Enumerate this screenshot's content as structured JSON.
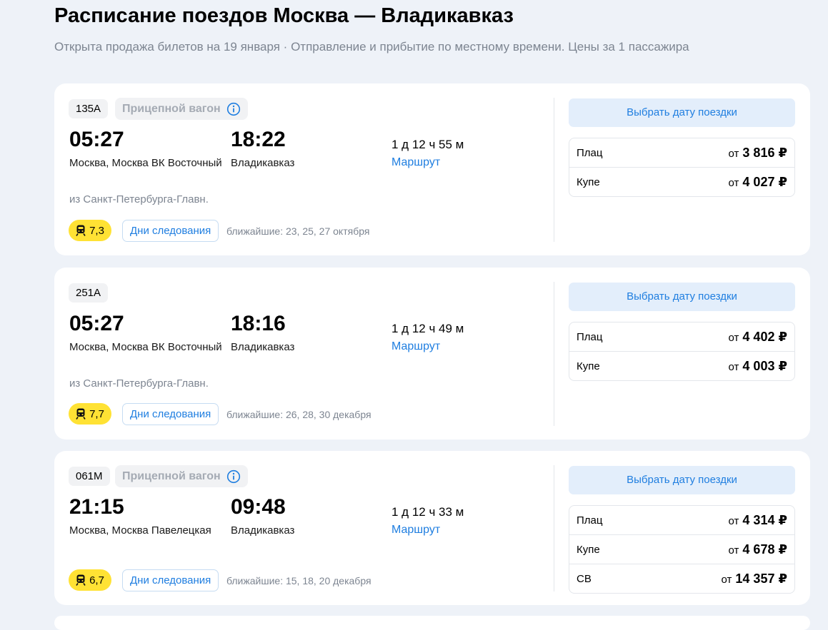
{
  "page": {
    "title": "Расписание поездов Москва — Владикавказ",
    "subtitle": "Открыта продажа билетов на 19 января · Отправление и прибытие по местному времени. Цены за 1 пассажира"
  },
  "colors": {
    "accent": "#1f7ee0",
    "rating_bg": "#ffe234",
    "page_bg": "#eef2f8"
  },
  "trains": [
    {
      "number": "135А",
      "wagon_badge": "Прицепной вагон",
      "departure_time": "05:27",
      "departure_station": "Москва, Москва ВК Восточный",
      "origin": "из Санкт-Петербурга-Главн.",
      "arrival_time": "18:22",
      "arrival_station": "Владикавказ",
      "duration": "1 д 12 ч 55 м",
      "route_label": "Маршрут",
      "rating": "7,3",
      "days_label": "Дни следования",
      "nearest": "ближайшие: 23, 25, 27 октября",
      "choose_label": "Выбрать дату поездки",
      "prices": [
        {
          "class": "Плац",
          "from": "от",
          "amount": "3 816 ₽"
        },
        {
          "class": "Купе",
          "from": "от",
          "amount": "4 027 ₽"
        }
      ]
    },
    {
      "number": "251А",
      "departure_time": "05:27",
      "departure_station": "Москва, Москва ВК Восточный",
      "origin": "из Санкт-Петербурга-Главн.",
      "arrival_time": "18:16",
      "arrival_station": "Владикавказ",
      "duration": "1 д 12 ч 49 м",
      "route_label": "Маршрут",
      "rating": "7,7",
      "days_label": "Дни следования",
      "nearest": "ближайшие: 26, 28, 30 декабря",
      "choose_label": "Выбрать дату поездки",
      "prices": [
        {
          "class": "Плац",
          "from": "от",
          "amount": "4 402 ₽"
        },
        {
          "class": "Купе",
          "from": "от",
          "amount": "4 003 ₽"
        }
      ]
    },
    {
      "number": "061М",
      "wagon_badge": "Прицепной вагон",
      "departure_time": "21:15",
      "departure_station": "Москва, Москва Павелецкая",
      "arrival_time": "09:48",
      "arrival_station": "Владикавказ",
      "duration": "1 д 12 ч 33 м",
      "route_label": "Маршрут",
      "rating": "6,7",
      "days_label": "Дни следования",
      "nearest": "ближайшие: 15, 18, 20 декабря",
      "choose_label": "Выбрать дату поездки",
      "prices": [
        {
          "class": "Плац",
          "from": "от",
          "amount": "4 314 ₽"
        },
        {
          "class": "Купе",
          "from": "от",
          "amount": "4 678 ₽"
        },
        {
          "class": "СВ",
          "from": "от",
          "amount": "14 357 ₽"
        }
      ]
    }
  ]
}
